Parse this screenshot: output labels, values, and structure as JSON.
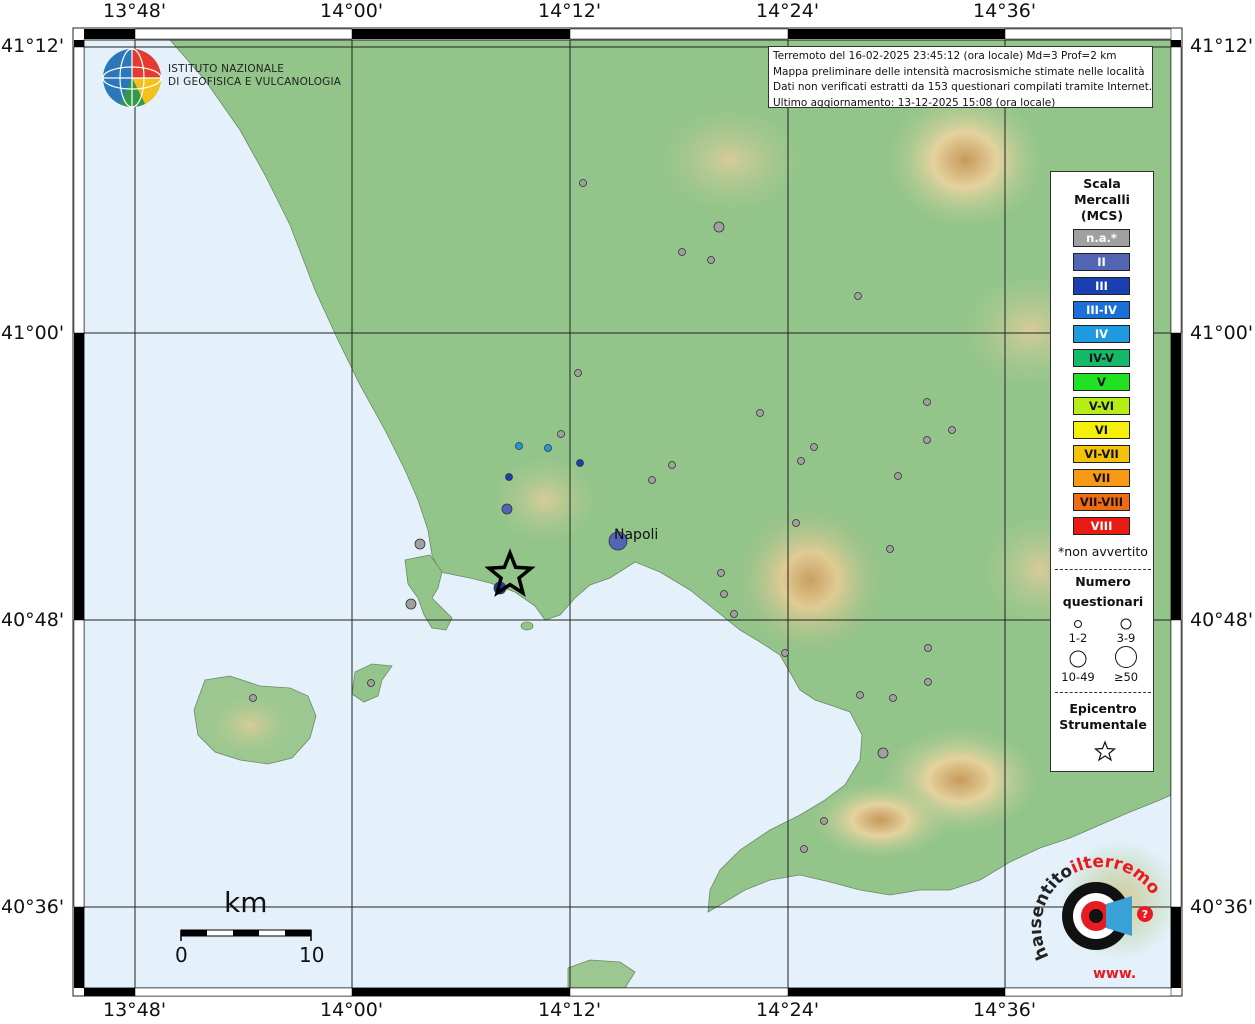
{
  "info": {
    "line1": "Terremoto del 16-02-2025 23:45:12 (ora locale) Md=3 Prof=2 km",
    "line2": "Mappa preliminare delle intensità macrosismiche stimate nelle località",
    "line3": "Dati non verificati estratti da 153 questionari compilati tramite Internet.",
    "line4": "Ultimo aggiornamento: 13-12-2025 15:08 (ora locale)"
  },
  "logo": {
    "line1": "ISTITUTO NAZIONALE",
    "line2": "DI GEOFISICA E VULCANOLOGIA"
  },
  "axes": {
    "lon_labels": [
      "13°48'",
      "14°00'",
      "14°12'",
      "14°24'",
      "14°36'"
    ],
    "lat_labels": [
      "41°12'",
      "41°00'",
      "40°48'",
      "40°36'"
    ]
  },
  "city": "Napoli",
  "scale": {
    "title": "km",
    "min": "0",
    "max": "10"
  },
  "legend": {
    "title1": "Scala",
    "title2": "Mercalli",
    "title3": "(MCS)",
    "classes": [
      {
        "label": "n.a.*",
        "color": "#a0a0a0",
        "text": "#ffffff"
      },
      {
        "label": "II",
        "color": "#5366b5",
        "text": "#ffffff"
      },
      {
        "label": "III",
        "color": "#1a3fb0",
        "text": "#ffffff"
      },
      {
        "label": "III-IV",
        "color": "#1a6fd8",
        "text": "#ffffff"
      },
      {
        "label": "IV",
        "color": "#1e9be0",
        "text": "#ffffff"
      },
      {
        "label": "IV-V",
        "color": "#16b86a",
        "text": "#111111"
      },
      {
        "label": "V",
        "color": "#22e022",
        "text": "#111111"
      },
      {
        "label": "V-VI",
        "color": "#b4ee14",
        "text": "#111111"
      },
      {
        "label": "VI",
        "color": "#f5f00a",
        "text": "#111111"
      },
      {
        "label": "VI-VII",
        "color": "#f5c20a",
        "text": "#111111"
      },
      {
        "label": "VII",
        "color": "#f59a12",
        "text": "#111111"
      },
      {
        "label": "VII-VIII",
        "color": "#f06a12",
        "text": "#111111"
      },
      {
        "label": "VIII",
        "color": "#e81a12",
        "text": "#ffffff"
      }
    ],
    "note": "*non avvertito",
    "count_title1": "Numero",
    "count_title2": "questionari",
    "sizes": [
      "1-2",
      "3-9",
      "10-49",
      "≥50"
    ],
    "epicenter_title1": "Epicentro",
    "epicenter_title2": "Strumentale"
  },
  "watermark": {
    "text1": "haisentito",
    "text2": "ilterremoto.it",
    "text3": "www."
  },
  "colors": {
    "sea": "#e4f1fb",
    "land": "#93c48a",
    "mountain": "#d8c28a"
  }
}
